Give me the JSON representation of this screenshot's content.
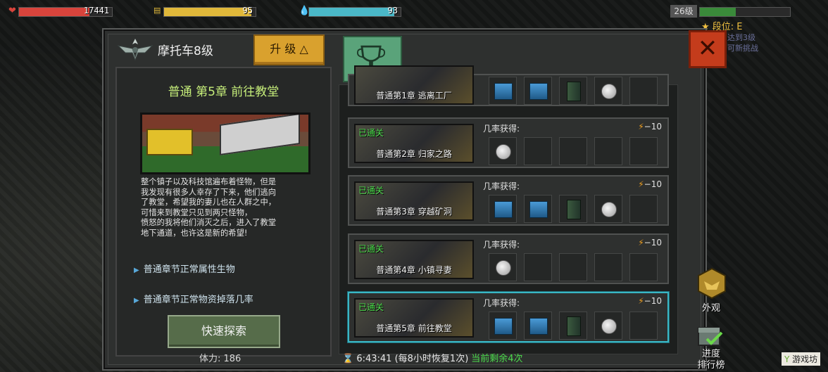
{
  "hud": {
    "hp": {
      "value": "17441",
      "fill": 0.76,
      "color": "#d8443c"
    },
    "energy": {
      "value": "95",
      "fill": 0.95,
      "color": "#e0b83a"
    },
    "water": {
      "value": "93",
      "fill": 0.93,
      "color": "#4ab8c8"
    },
    "level": "26级",
    "xp_fill": 0.4,
    "rank": "段位: E",
    "rank_sub1": "达到3级",
    "rank_sub2": "可新挑战"
  },
  "header": {
    "vehicle_title": "摩托车8级",
    "upgrade_label": "升 级",
    "close_icon": "close-icon"
  },
  "detail": {
    "chapter_title": "普通 第5章 前往教堂",
    "story_lines": [
      "整个镇子以及科技馆遍布着怪物，但是",
      "我发现有很多人幸存了下来，他们逃向",
      "了教堂，希望我的妻儿也在人群之中，",
      "可惜来到教堂只见到两只怪物，",
      "愤怒的我将他们消灭之后，进入了教堂",
      "地下通道，也许这是新的希望!"
    ],
    "bullet1": "普通章节正常属性生物",
    "bullet2": "普通章节正常物资掉落几率",
    "explore_label": "快速探索",
    "stamina": "体力: 186"
  },
  "stages": [
    {
      "name": "普通第1章 逃离工厂",
      "cleared": "",
      "drop": "",
      "cost": "",
      "slots": [
        "item",
        "item",
        "item2",
        "coin",
        "empty"
      ]
    },
    {
      "name": "普通第2章 归家之路",
      "cleared": "已通关",
      "drop": "几率获得:",
      "cost": "−10",
      "slots": [
        "coin",
        "empty",
        "empty",
        "empty",
        "empty"
      ]
    },
    {
      "name": "普通第3章 穿越矿洞",
      "cleared": "已通关",
      "drop": "几率获得:",
      "cost": "−10",
      "slots": [
        "item",
        "item",
        "item2",
        "coin",
        "empty"
      ]
    },
    {
      "name": "普通第4章 小镇寻妻",
      "cleared": "已通关",
      "drop": "几率获得:",
      "cost": "−10",
      "slots": [
        "coin",
        "empty",
        "empty",
        "empty",
        "empty"
      ]
    },
    {
      "name": "普通第5章 前往教堂",
      "cleared": "已通关",
      "drop": "几率获得:",
      "cost": "−10",
      "slots": [
        "item",
        "item",
        "item2",
        "coin",
        "empty"
      ]
    }
  ],
  "footer": {
    "timer": "6:43:41 (每8小时恢复1次)",
    "remaining": "当前剩余4次"
  },
  "side": {
    "appearance": "外观",
    "progress1": "进度",
    "progress2": "排行榜"
  },
  "watermark": "游戏坊"
}
